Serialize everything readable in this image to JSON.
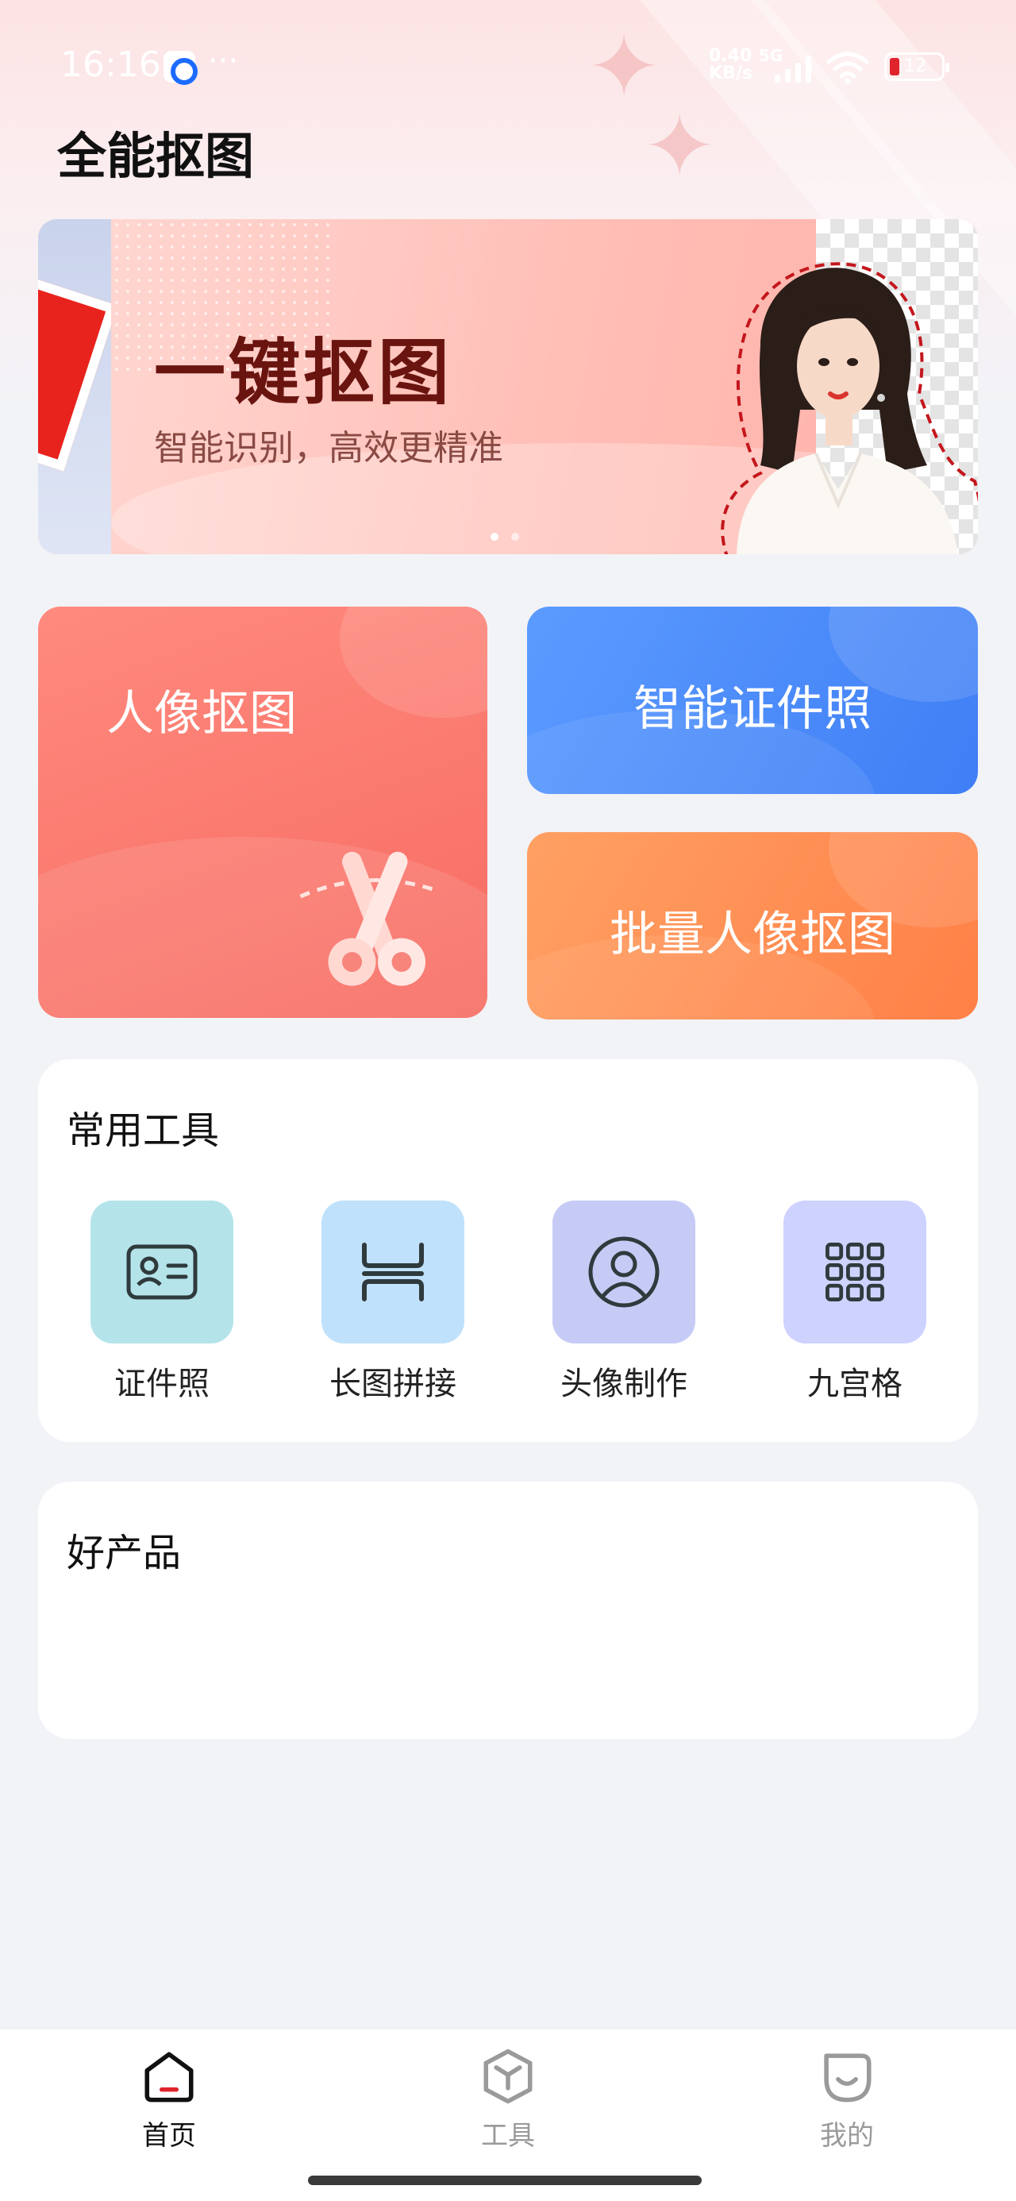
{
  "status_bar": {
    "time": "16:16",
    "more": "···",
    "net_speed_value": "0.40",
    "net_speed_unit": "KB/s",
    "network": "5G",
    "battery": "12"
  },
  "page": {
    "title": "全能抠图"
  },
  "banner": {
    "title": "一键抠图",
    "subtitle": "智能识别，高效更精准"
  },
  "features": {
    "portrait": "人像抠图",
    "id_photo": "智能证件照",
    "batch": "批量人像抠图"
  },
  "tools": {
    "title": "常用工具",
    "items": [
      {
        "label": "证件照",
        "icon": "id-card-icon",
        "color": "#b4e4ea"
      },
      {
        "label": "长图拼接",
        "icon": "long-image-stitch-icon",
        "color": "#bfe1fb"
      },
      {
        "label": "头像制作",
        "icon": "avatar-icon",
        "color": "#c6cbf5"
      },
      {
        "label": "九宫格",
        "icon": "grid-icon",
        "color": "#cdd2ff"
      }
    ]
  },
  "products": {
    "title": "好产品"
  },
  "bottom_nav": {
    "items": [
      {
        "label": "首页",
        "icon": "home-icon",
        "active": true
      },
      {
        "label": "工具",
        "icon": "tools-box-icon",
        "active": false
      },
      {
        "label": "我的",
        "icon": "profile-icon",
        "active": false
      }
    ]
  },
  "colors": {
    "accent_red": "#e0242b",
    "portrait_card": "#f76b62",
    "id_card": "#3f7ef5",
    "batch_card": "#ff8047"
  }
}
